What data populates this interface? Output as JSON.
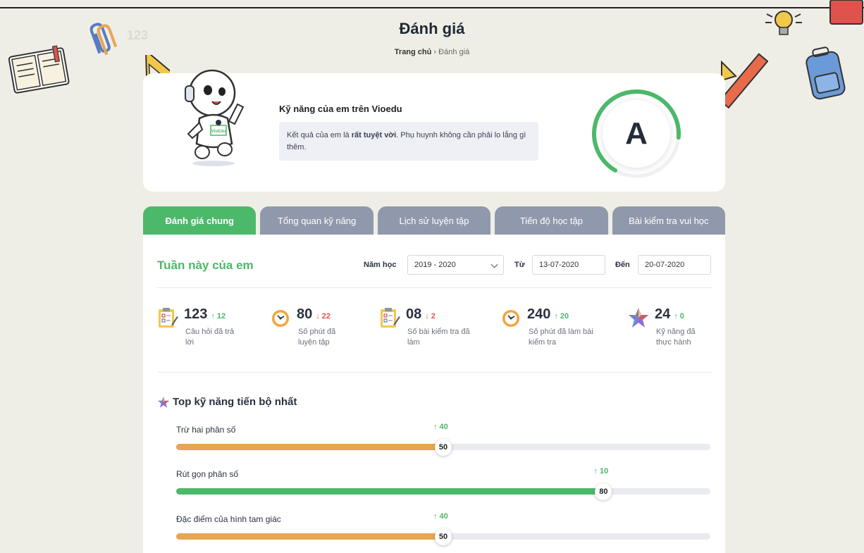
{
  "page": {
    "title": "Đánh giá",
    "breadcrumb": {
      "home": "Trang chủ",
      "separator": "›",
      "current": "Đánh giá"
    }
  },
  "hero": {
    "heading": "Kỹ năng của em trên Vioedu",
    "message_prefix": "Kết quả của em là ",
    "message_bold": "rất tuyệt vời",
    "message_suffix": ". Phụ huynh không cần phải lo lắng gì thêm.",
    "grade": "A",
    "grade_progress": 0.68,
    "robot_badge": "VioEdu"
  },
  "tabs": [
    {
      "label": "Đánh giá chung",
      "active": true
    },
    {
      "label": "Tổng quan kỹ năng",
      "active": false
    },
    {
      "label": "Lịch sử luyện tập",
      "active": false
    },
    {
      "label": "Tiến độ học tập",
      "active": false
    },
    {
      "label": "Bài kiểm tra vui học",
      "active": false
    }
  ],
  "filters": {
    "section_title": "Tuần này của em",
    "year_label": "Năm học",
    "year_value": "2019 - 2020",
    "from_label": "Từ",
    "from_value": "13-07-2020",
    "to_label": "Đến",
    "to_value": "20-07-2020"
  },
  "stats": [
    {
      "icon": "clipboard-icon",
      "value": "123",
      "delta": "↑ 12",
      "trend": "up",
      "label": "Câu hỏi đã trả lời"
    },
    {
      "icon": "clock-icon",
      "value": "80",
      "delta": "↓ 22",
      "trend": "down",
      "label": "Số phút đã luyện tập"
    },
    {
      "icon": "clipboard-icon",
      "value": "08",
      "delta": "↓ 2",
      "trend": "down",
      "label": "Số bài kiểm tra đã làm"
    },
    {
      "icon": "clock-icon",
      "value": "240",
      "delta": "↑ 20",
      "trend": "up",
      "label": "Số phút đã làm bài kiểm tra"
    },
    {
      "icon": "star-icon",
      "value": "24",
      "delta": "↑ 0",
      "trend": "up",
      "label": "Kỹ năng đã thực hành"
    }
  ],
  "top_skills": {
    "title": "Top kỹ năng tiến bộ nhất",
    "items": [
      {
        "name": "Trừ hai phân số",
        "score": 50,
        "delta": "↑ 40",
        "color": "#e8a552"
      },
      {
        "name": "Rút gọn phân số",
        "score": 80,
        "delta": "↑ 10",
        "color": "#4cb86a"
      },
      {
        "name": "Đặc điểm của hình tam giác",
        "score": 50,
        "delta": "↑ 40",
        "color": "#e8a552"
      }
    ]
  },
  "colors": {
    "accent": "#4cb86a",
    "tab_inactive": "#9099ab",
    "orange": "#e8a552",
    "down": "#e0534c",
    "background": "#efeee6"
  },
  "decor_text": "123"
}
